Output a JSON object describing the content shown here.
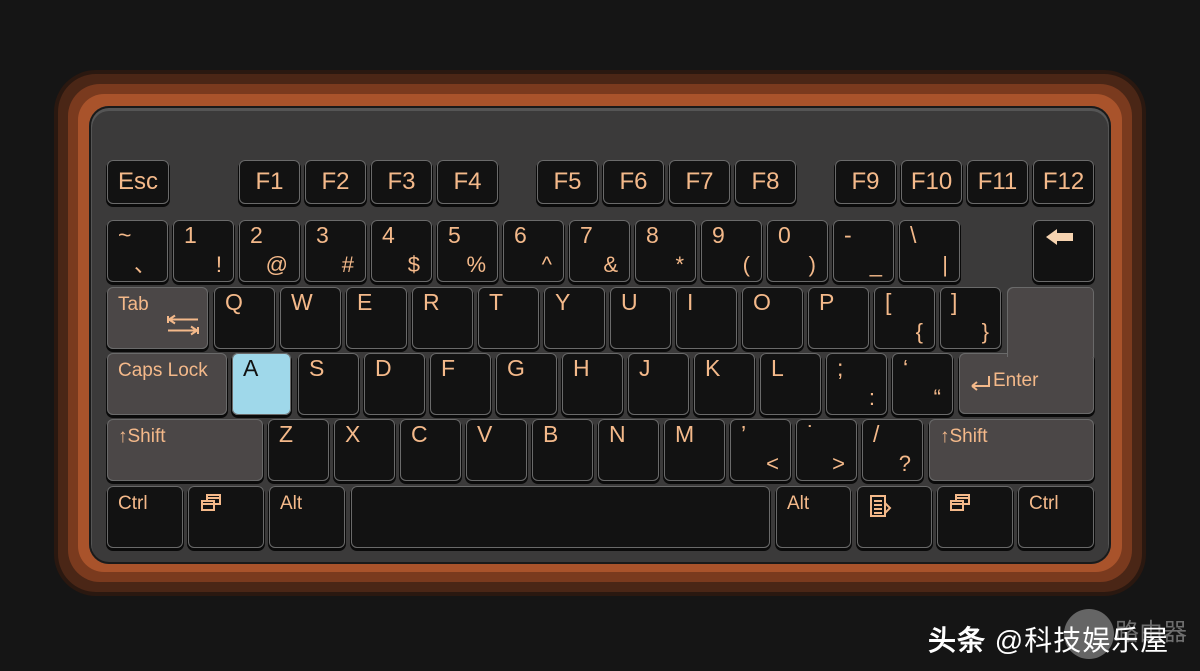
{
  "colors": {
    "background": "#151515",
    "frame": "#a9532b",
    "body": "#3b3a3a",
    "key": "#121212",
    "modifier_key": "#4b4747",
    "highlighted_key": "#9fd8ea",
    "legend": "#f4b98a"
  },
  "highlighted_key": "A",
  "rows": [
    [
      {
        "p": "Esc",
        "t": "fn"
      },
      {
        "p": "F1",
        "t": "fn"
      },
      {
        "p": "F2",
        "t": "fn"
      },
      {
        "p": "F3",
        "t": "fn"
      },
      {
        "p": "F4",
        "t": "fn"
      },
      {
        "p": "F5",
        "t": "fn"
      },
      {
        "p": "F6",
        "t": "fn"
      },
      {
        "p": "F7",
        "t": "fn"
      },
      {
        "p": "F8",
        "t": "fn"
      },
      {
        "p": "F9",
        "t": "fn"
      },
      {
        "p": "F10",
        "t": "fn"
      },
      {
        "p": "F11",
        "t": "fn"
      },
      {
        "p": "F12",
        "t": "fn"
      }
    ],
    [
      {
        "p": "~",
        "s": "、"
      },
      {
        "p": "1",
        "s": "!"
      },
      {
        "p": "2",
        "s": "@"
      },
      {
        "p": "3",
        "s": "#"
      },
      {
        "p": "4",
        "s": "$"
      },
      {
        "p": "5",
        "s": "%"
      },
      {
        "p": "6",
        "s": "^"
      },
      {
        "p": "7",
        "s": "&"
      },
      {
        "p": "8",
        "s": "*"
      },
      {
        "p": "9",
        "s": "("
      },
      {
        "p": "0",
        "s": ")"
      },
      {
        "p": "-",
        "s": "_"
      },
      {
        "p": "+",
        "s": "="
      },
      {
        "p": "\\",
        "s": "|"
      },
      {
        "icon": "backspace-arrow-icon"
      }
    ],
    [
      {
        "p": "Tab",
        "icon": "tab-arrows-icon",
        "t": "mod"
      },
      {
        "p": "Q"
      },
      {
        "p": "W"
      },
      {
        "p": "E"
      },
      {
        "p": "R"
      },
      {
        "p": "T"
      },
      {
        "p": "Y"
      },
      {
        "p": "U"
      },
      {
        "p": "I"
      },
      {
        "p": "O"
      },
      {
        "p": "P"
      },
      {
        "p": "[",
        "s": "{"
      },
      {
        "p": "]",
        "s": "}"
      }
    ],
    [
      {
        "p": "Caps Lock",
        "t": "mod"
      },
      {
        "p": "A"
      },
      {
        "p": "S"
      },
      {
        "p": "D"
      },
      {
        "p": "F"
      },
      {
        "p": "G"
      },
      {
        "p": "H"
      },
      {
        "p": "J"
      },
      {
        "p": "K"
      },
      {
        "p": "L"
      },
      {
        "p": ";",
        "s": ":"
      },
      {
        "p": "‘",
        "s": "“"
      },
      {
        "p": "Enter",
        "icon": "enter-arrow-icon",
        "t": "mod"
      }
    ],
    [
      {
        "p": "↑Shift",
        "t": "mod"
      },
      {
        "p": "Z"
      },
      {
        "p": "X"
      },
      {
        "p": "C"
      },
      {
        "p": "V"
      },
      {
        "p": "B"
      },
      {
        "p": "N"
      },
      {
        "p": "M"
      },
      {
        "p": "’",
        "s": "<"
      },
      {
        "p": "˙",
        "s": ">"
      },
      {
        "p": "/",
        "s": "?"
      },
      {
        "p": "↑Shift",
        "t": "mod"
      }
    ],
    [
      {
        "p": "Ctrl",
        "t": "mod"
      },
      {
        "icon": "windows-icon"
      },
      {
        "p": "Alt",
        "t": "mod"
      },
      {
        "p": "",
        "name": "space"
      },
      {
        "p": "Alt",
        "t": "mod"
      },
      {
        "icon": "menu-icon"
      },
      {
        "icon": "windows-icon"
      },
      {
        "p": "Ctrl",
        "t": "mod"
      }
    ]
  ],
  "watermark": {
    "platform": "头条",
    "handle": "@科技娱乐屋",
    "logo_text": "路由器"
  }
}
